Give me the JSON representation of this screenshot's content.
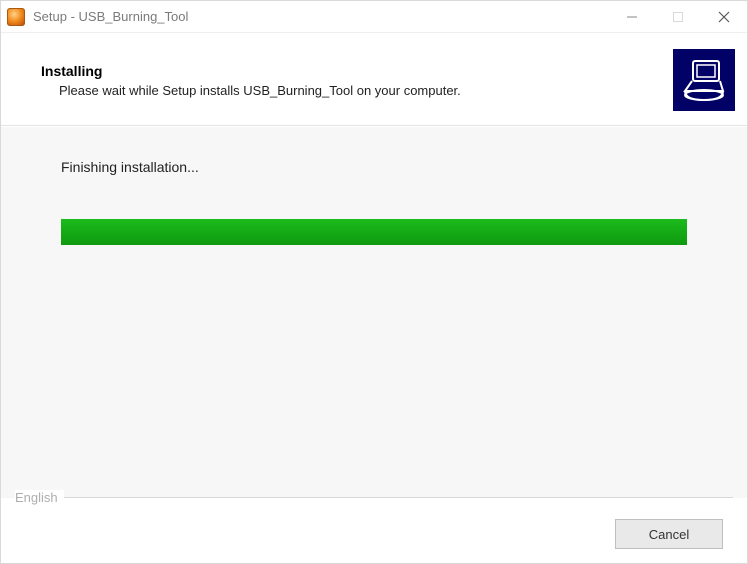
{
  "titlebar": {
    "title": "Setup - USB_Burning_Tool"
  },
  "header": {
    "heading": "Installing",
    "subtext": "Please wait while Setup installs USB_Burning_Tool on your computer."
  },
  "content": {
    "status": "Finishing installation...",
    "progress_percent": 100
  },
  "footer": {
    "language_label": "English",
    "cancel_label": "Cancel"
  }
}
